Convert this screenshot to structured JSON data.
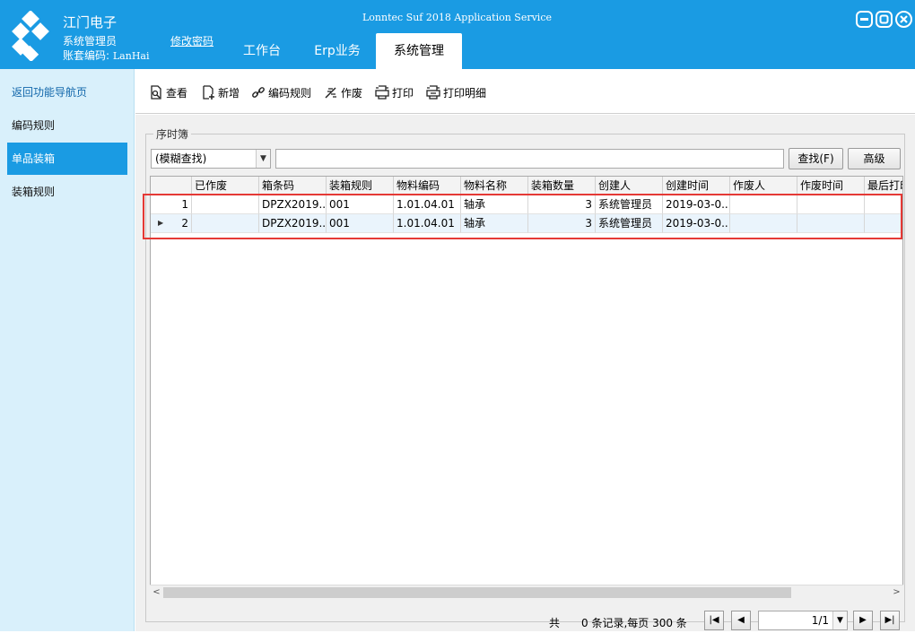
{
  "header": {
    "company": "江门电子",
    "role": "系统管理员",
    "account_label": "账套编码:",
    "account_code": "LanHai",
    "change_password": "修改密码",
    "app_title": "Lonntec Suf 2018 Application Service",
    "tabs": [
      {
        "label": "工作台"
      },
      {
        "label": "Erp业务"
      },
      {
        "label": "系统管理",
        "active": true
      }
    ],
    "colors": {
      "bar": "#1a9be3"
    }
  },
  "sidebar": {
    "items": [
      {
        "label": "返回功能导航页"
      },
      {
        "label": "编码规则"
      },
      {
        "label": "单品装箱",
        "active": true
      },
      {
        "label": "装箱规则"
      }
    ]
  },
  "toolbar": {
    "buttons": [
      {
        "label": "查看",
        "icon": "view-icon"
      },
      {
        "label": "新增",
        "icon": "new-icon"
      },
      {
        "label": "编码规则",
        "icon": "link-icon"
      },
      {
        "label": "作废",
        "icon": "void-icon"
      },
      {
        "label": "打印",
        "icon": "print-icon"
      },
      {
        "label": "打印明细",
        "icon": "print-detail-icon"
      }
    ]
  },
  "panel": {
    "title": "序时簿",
    "search_mode": "(模糊查找)",
    "search_value": "",
    "find_button": "查找(F)",
    "advanced_button": "高级"
  },
  "grid": {
    "columns": [
      "",
      "已作废",
      "箱条码",
      "装箱规则",
      "物料编码",
      "物料名称",
      "装箱数量",
      "创建人",
      "创建时间",
      "作废人",
      "作废时间",
      "最后打印"
    ],
    "rows": [
      {
        "index": "1",
        "voided": "",
        "barcode": "DPZX2019...",
        "rule": "001",
        "material_code": "1.01.04.01",
        "material_name": "轴承",
        "qty": "3",
        "creator": "系统管理员",
        "created": "2019-03-0...",
        "voider": "",
        "void_time": "",
        "last_print": ""
      },
      {
        "index": "2",
        "voided": "",
        "barcode": "DPZX2019...",
        "rule": "001",
        "material_code": "1.01.04.01",
        "material_name": "轴承",
        "qty": "3",
        "creator": "系统管理员",
        "created": "2019-03-0...",
        "voider": "",
        "void_time": "",
        "last_print": ""
      }
    ]
  },
  "pager": {
    "total_prefix": "共",
    "summary": "0 条记录,每页 300 条",
    "page": "1/1"
  }
}
